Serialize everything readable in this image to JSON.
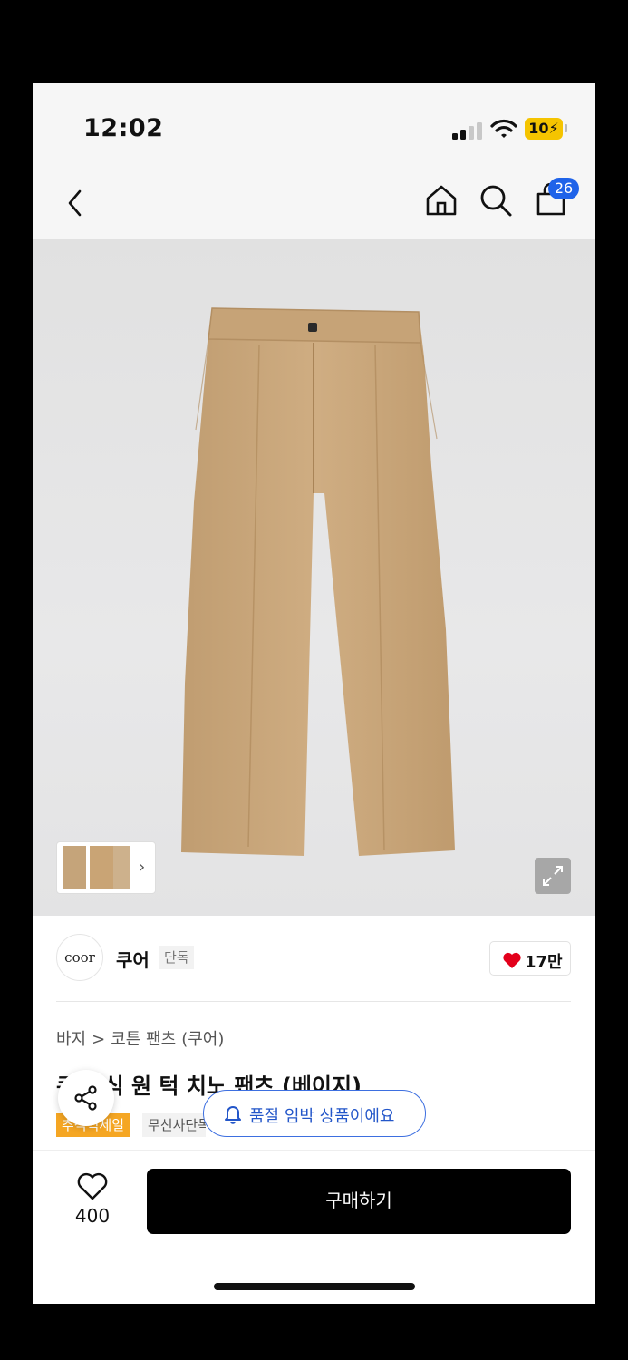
{
  "status_bar": {
    "time": "12:02",
    "battery": "10"
  },
  "nav": {
    "back_icon": "chevron-left-icon",
    "home_icon": "home-icon",
    "search_icon": "search-icon",
    "cart_icon": "shopping-bag-icon",
    "cart_count": "26"
  },
  "gallery": {
    "thumb_arrow": "›",
    "expand_icon": "expand-icon"
  },
  "brand": {
    "logo_text": "coor",
    "name": "쿠어",
    "tag": "단독",
    "like_count": "17만"
  },
  "product": {
    "breadcrumb": [
      "바지",
      ">",
      "코튼 팬츠",
      "(쿠어)"
    ],
    "title": "쿠어 식 원 턱 치노 팬츠 (베이지)",
    "sale_badge": "추석빅세일",
    "exclusive_badge": "무신사단독"
  },
  "stock_notice": "품절 임박 상품이에요",
  "bottom": {
    "wish_count": "400",
    "buy_label": "구매하기"
  },
  "colors": {
    "accent_blue": "#1f63e9",
    "sale_orange": "#f5a623",
    "heart_red": "#e3001b",
    "pants_beige": "#c8a57a"
  }
}
